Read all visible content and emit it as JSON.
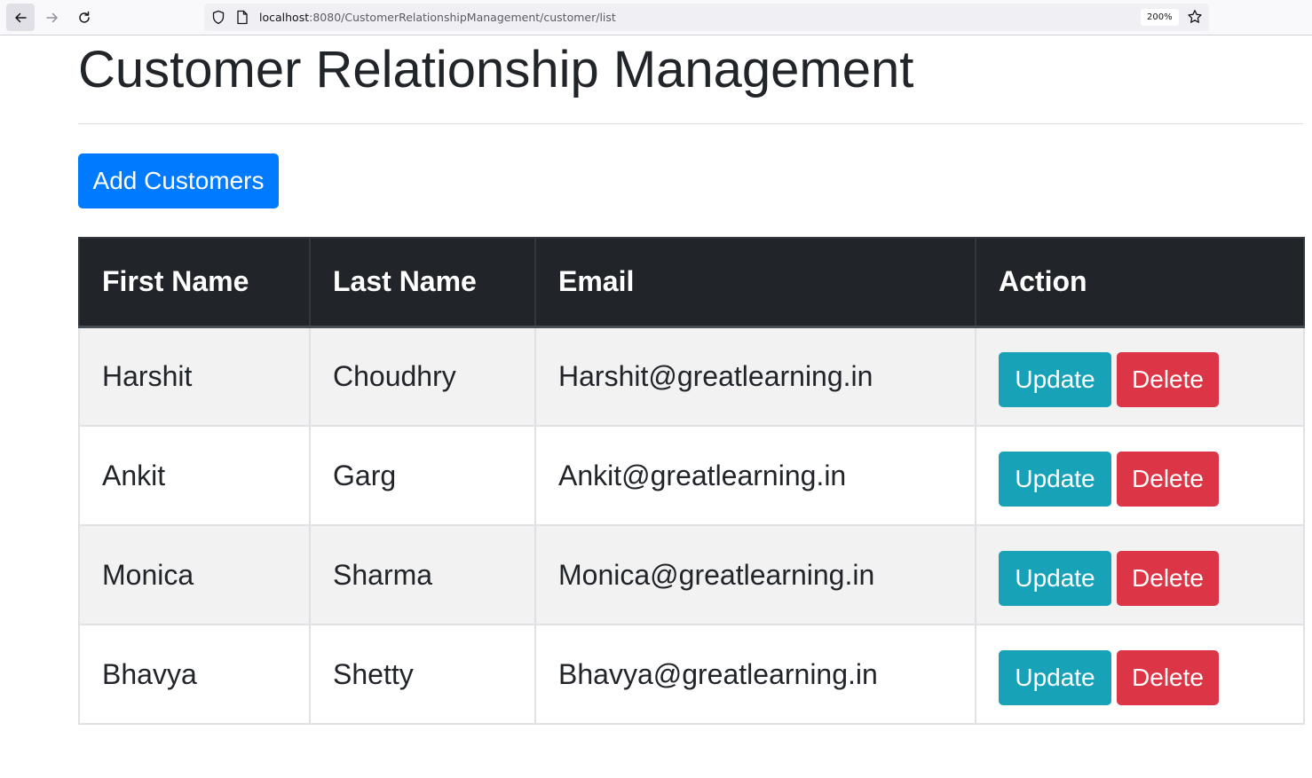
{
  "browser": {
    "url_host": "localhost",
    "url_rest": ":8080/CustomerRelationshipManagement/customer/list",
    "zoom": "200%"
  },
  "page": {
    "title": "Customer Relationship Management",
    "add_button": "Add Customers"
  },
  "table": {
    "headers": [
      "First Name",
      "Last Name",
      "Email",
      "Action"
    ],
    "rows": [
      {
        "first": "Harshit",
        "last": "Choudhry",
        "email": "Harshit@greatlearning.in",
        "update": "Update",
        "delete": "Delete"
      },
      {
        "first": "Ankit",
        "last": "Garg",
        "email": "Ankit@greatlearning.in",
        "update": "Update",
        "delete": "Delete"
      },
      {
        "first": "Monica",
        "last": "Sharma",
        "email": "Monica@greatlearning.in",
        "update": "Update",
        "delete": "Delete"
      },
      {
        "first": "Bhavya",
        "last": "Shetty",
        "email": "Bhavya@greatlearning.in",
        "update": "Update",
        "delete": "Delete"
      }
    ]
  },
  "colors": {
    "primary": "#007bff",
    "update": "#17a2b8",
    "delete": "#dc3545",
    "table_header": "#212529"
  },
  "icons": [
    "back-arrow-icon",
    "forward-arrow-icon",
    "reload-icon",
    "shield-icon",
    "page-icon",
    "star-icon"
  ]
}
